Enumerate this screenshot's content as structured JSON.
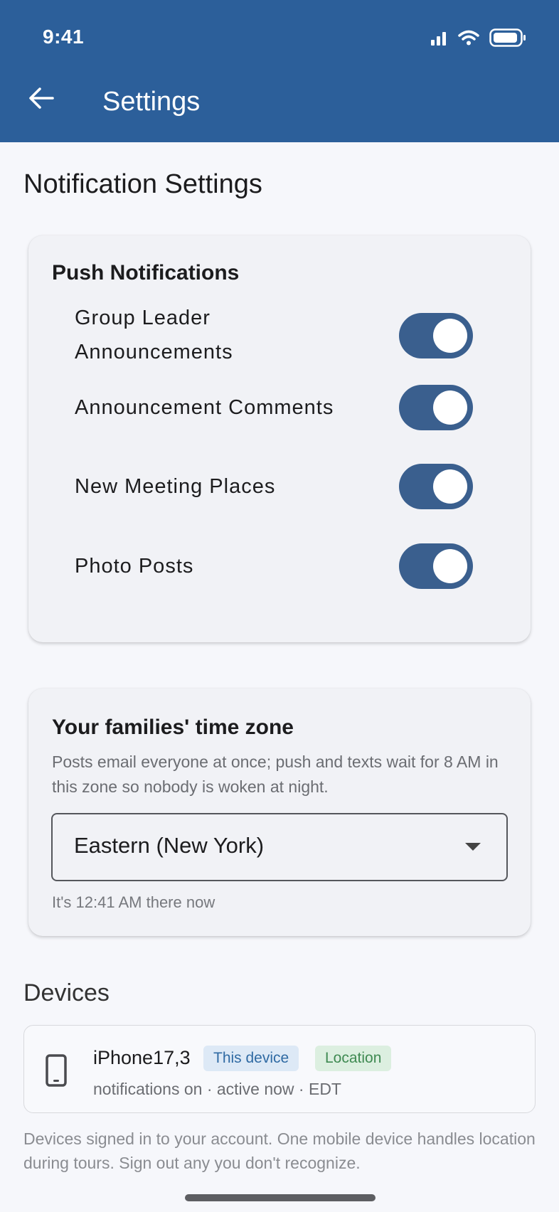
{
  "status_bar": {
    "time": "9:41"
  },
  "app_bar": {
    "title": "Settings"
  },
  "notification_settings": {
    "title": "Notification Settings"
  },
  "push": {
    "heading": "Push Notifications",
    "items": [
      {
        "label_line1": "Group Leader",
        "label_line2": "Announcements",
        "on": true
      },
      {
        "label": "Announcement Comments",
        "on": true
      },
      {
        "label": "New Meeting Places",
        "on": true
      },
      {
        "label": "Photo Posts",
        "on": true
      }
    ]
  },
  "timezone": {
    "heading": "Your families' time zone",
    "description": "Posts email everyone at once; push and texts wait for 8 AM in this zone so nobody is woken at night.",
    "selected": "Eastern (New York)",
    "now_text": "It's 12:41 AM there now"
  },
  "devices": {
    "title": "Devices",
    "items": [
      {
        "name": "iPhone17,3",
        "badge_this": "This device",
        "badge_location": "Location",
        "meta": "notifications on · active now · EDT"
      }
    ],
    "note": "Devices signed in to your account. One mobile device handles location during tours. Sign out any you don't recognize."
  },
  "colors": {
    "app_bar": "#2c5f9a",
    "toggle_on": "#3a5f8e",
    "badge_this_bg": "#dde9f6",
    "badge_location_bg": "#dcefe0"
  },
  "icons": {
    "back": "arrow-left-icon",
    "signal": "signal-icon",
    "wifi": "wifi-icon",
    "battery": "battery-icon",
    "dropdown": "caret-down-icon",
    "device": "smartphone-icon"
  }
}
